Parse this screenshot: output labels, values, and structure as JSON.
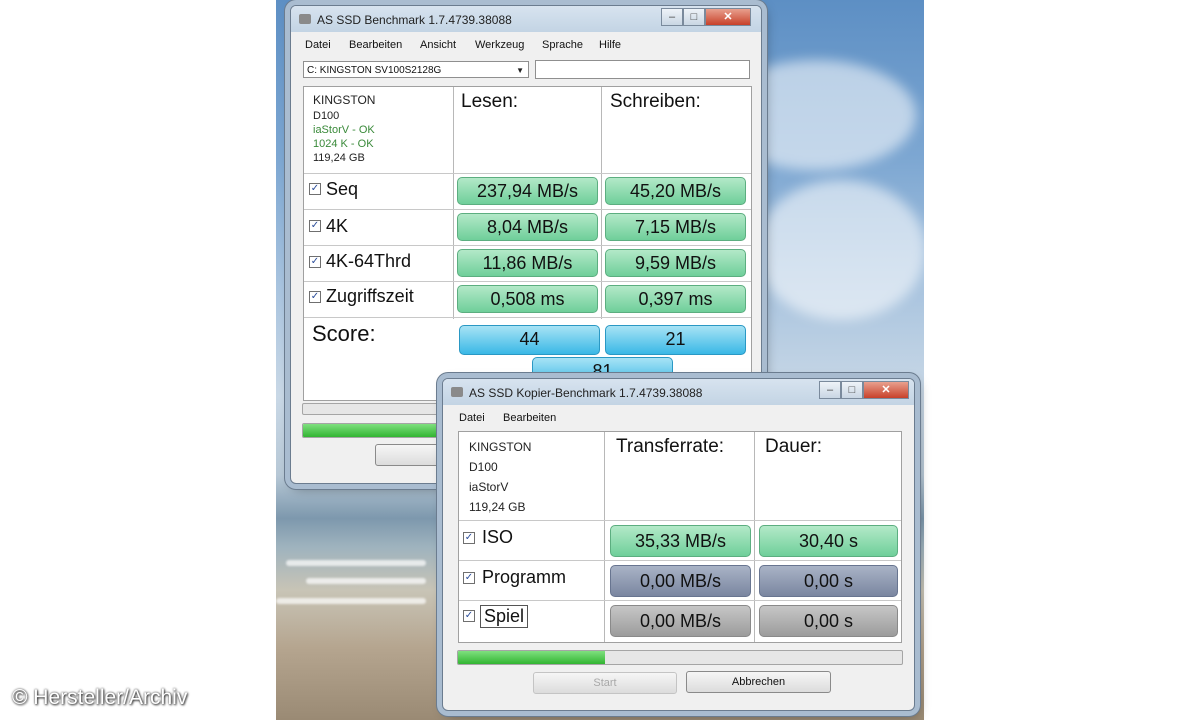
{
  "credit": "© Hersteller/Archiv",
  "main_window": {
    "title": "AS SSD Benchmark 1.7.4739.38088",
    "menu": [
      "Datei",
      "Bearbeiten",
      "Ansicht",
      "Werkzeug",
      "Sprache",
      "Hilfe"
    ],
    "drive_select": "C: KINGSTON SV100S2128G",
    "search_value": "",
    "info": {
      "brand": "KINGSTON",
      "model": "D100",
      "driver": "iaStorV - OK",
      "alignment": "1024 K - OK",
      "size": "119,24 GB"
    },
    "col_read": "Lesen:",
    "col_write": "Schreiben:",
    "rows": [
      {
        "label": "Seq",
        "read": "237,94 MB/s",
        "write": "45,20 MB/s"
      },
      {
        "label": "4K",
        "read": "8,04 MB/s",
        "write": "7,15 MB/s"
      },
      {
        "label": "4K-64Thrd",
        "read": "11,86 MB/s",
        "write": "9,59 MB/s"
      },
      {
        "label": "Zugriffszeit",
        "read": "0,508 ms",
        "write": "0,397 ms"
      }
    ],
    "score_label": "Score:",
    "score_read": "44",
    "score_write": "21",
    "score_total": "81",
    "progress": 0.42
  },
  "copy_window": {
    "title": "AS SSD Kopier-Benchmark 1.7.4739.38088",
    "menu": [
      "Datei",
      "Bearbeiten"
    ],
    "info": {
      "brand": "KINGSTON",
      "model": "D100",
      "driver": "iaStorV",
      "size": "119,24 GB"
    },
    "col_rate": "Transferrate:",
    "col_duration": "Dauer:",
    "rows": [
      {
        "label": "ISO",
        "rate": "35,33 MB/s",
        "duration": "30,40 s"
      },
      {
        "label": "Programm",
        "rate": "0,00 MB/s",
        "duration": "0,00 s"
      },
      {
        "label": "Spiel",
        "rate": "0,00 MB/s",
        "duration": "0,00 s"
      }
    ],
    "progress": 0.33,
    "start_label": "Start",
    "cancel_label": "Abbrechen"
  },
  "colors": {
    "green": "#6fcf9a",
    "blue": "#3ab8e6",
    "slate": "#7a86a0",
    "gray": "#9c9c9c"
  }
}
